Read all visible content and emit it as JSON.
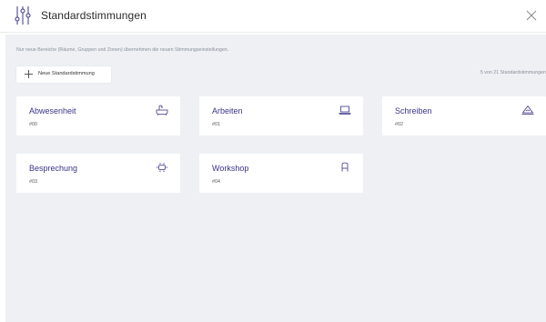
{
  "header": {
    "title": "Standardstimmungen",
    "icon": "sliders-icon",
    "close_icon": "close-icon"
  },
  "info_text": "Nur neue Bereiche (Räume, Gruppen und Zonen) übernehmen die neuen Stimmungseinstellungen.",
  "new_button_label": "Neue Standardstimmung",
  "count_text": "5 von 21 Standardstimmungen",
  "colors": {
    "accent": "#3b3488",
    "background": "#eef0f4",
    "card": "#ffffff"
  },
  "moods": [
    {
      "name": "Abwesenheit",
      "number": "#00",
      "icon": "bathtub-icon"
    },
    {
      "name": "Arbeiten",
      "number": "#01",
      "icon": "laptop-icon"
    },
    {
      "name": "Schreiben",
      "number": "#02",
      "icon": "desk-lamp-icon"
    },
    {
      "name": "Besprechung",
      "number": "#03",
      "icon": "meeting-table-icon"
    },
    {
      "name": "Workshop",
      "number": "#04",
      "icon": "chair-icon"
    }
  ]
}
